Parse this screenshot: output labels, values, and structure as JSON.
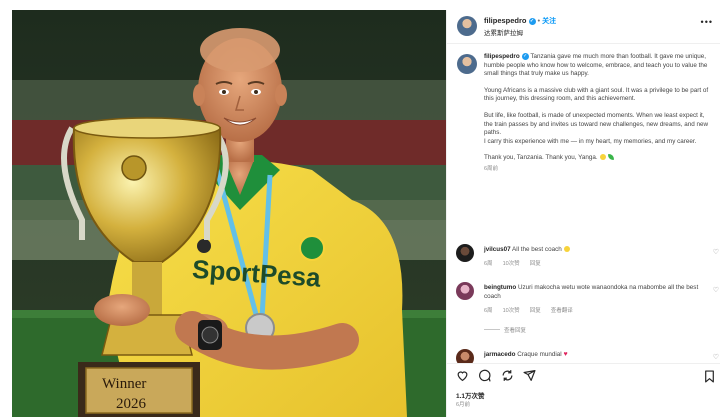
{
  "post": {
    "username": "filipespedro",
    "follow_label": "关注",
    "location": "达累斯萨拉姆",
    "photo": {
      "shirt_sponsor": "SportPesa",
      "trophy_text_line1": "Winner",
      "trophy_text_line2": "2026"
    },
    "caption": {
      "paragraphs": [
        "Tanzania gave me much more than football. It gave me unique, humble people who know how to welcome, embrace, and teach you to value the small things that truly make us happy.",
        "Young Africans is a massive club with a giant soul. It was a privilege to be part of this journey, this dressing room, and this achievement.",
        "But life, like football, is made of unexpected moments. When we least expect it, the train passes by and invites us toward new challenges, new dreams, and new paths.",
        "I carry this experience with me — in my heart, my memories, and my career.",
        "Thank you, Tanzania. Thank you, Yanga."
      ],
      "time": "6周前"
    },
    "comments": [
      {
        "user": "jvilcus07",
        "text": "All the best coach",
        "time": "6周",
        "likes": "10次赞",
        "reply": "回复"
      },
      {
        "user": "beingtumo",
        "text": "Uzuri makocha wetu wote wanaondoka na mabombe all the best coach",
        "time": "6周",
        "likes": "10次赞",
        "reply": "回复",
        "translate": "查看翻译",
        "replies": "查看回复"
      },
      {
        "user": "jarmacedo",
        "text": "Craque mundial"
      }
    ],
    "likes_count": "1.1万次赞",
    "date": "6月前"
  },
  "icons": {
    "more": "more-icon",
    "heart": "heart-icon",
    "comment": "comment-icon",
    "share": "share-icon",
    "save": "bookmark-icon"
  },
  "colors": {
    "link_blue": "#0095f6",
    "yanga_yellow": "#f7d33b",
    "yanga_green": "#1f8f3b",
    "heart_red": "#e0245e"
  }
}
